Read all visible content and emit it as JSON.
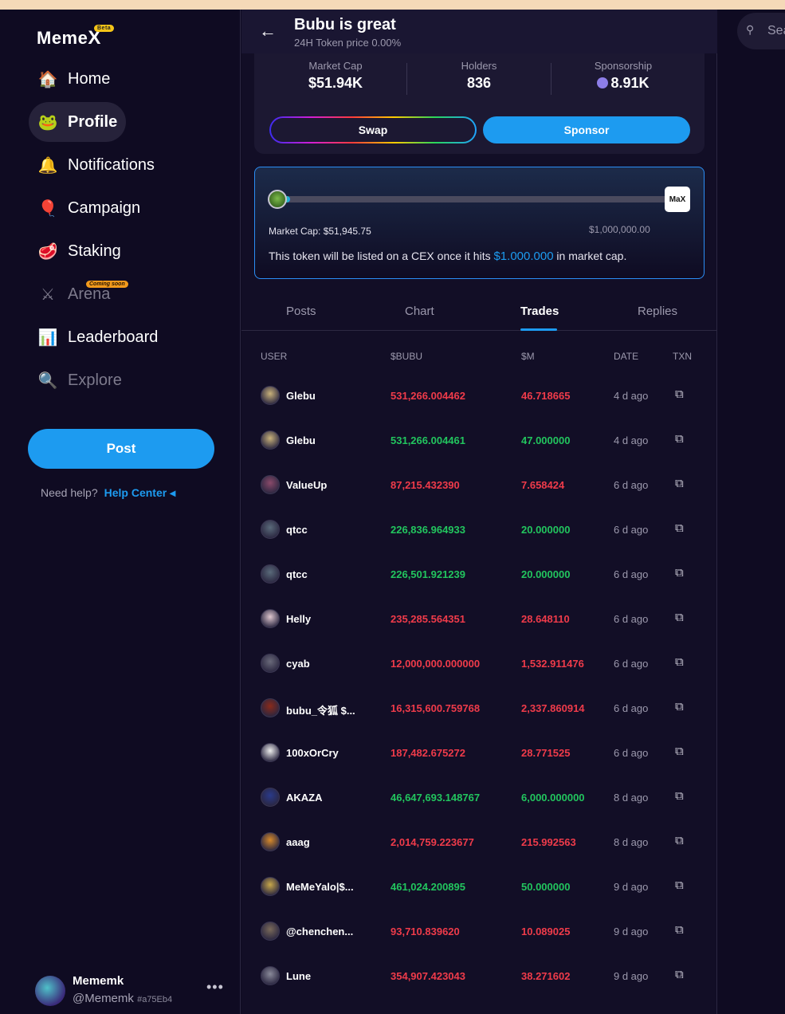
{
  "logo": {
    "text_a": "Meme",
    "text_b": "X",
    "beta": "Beta"
  },
  "nav": [
    {
      "label": "Home",
      "icon": "🏠"
    },
    {
      "label": "Profile",
      "icon": "🐸"
    },
    {
      "label": "Notifications",
      "icon": "🔔"
    },
    {
      "label": "Campaign",
      "icon": "🎈"
    },
    {
      "label": "Staking",
      "icon": "🥩"
    },
    {
      "label": "Arena",
      "icon": "⚔",
      "badge": "Coming soon"
    },
    {
      "label": "Leaderboard",
      "icon": "📊"
    },
    {
      "label": "Explore",
      "icon": "🔍"
    }
  ],
  "post_button": "Post",
  "help": {
    "prefix": "Need help?",
    "link": "Help Center ◂"
  },
  "user": {
    "name": "Mememk",
    "handle": "@Mememk",
    "tag": "#a75Eb4",
    "more": "•••"
  },
  "header": {
    "back": "←",
    "title": "Bubu is great",
    "subtitle": "24H Token price  0.00%"
  },
  "stats": [
    {
      "label": "Market Cap",
      "value": "$51.94K"
    },
    {
      "label": "Holders",
      "value": "836"
    },
    {
      "label": "Sponsorship",
      "value": "8.91K"
    }
  ],
  "buttons": {
    "swap": "Swap",
    "sponsor": "Sponsor"
  },
  "progress": {
    "fraction": 0.0519,
    "market_cap_label": "Market Cap: $51,945.75",
    "target_label": "$1,000,000.00",
    "max_badge": "MaX",
    "cex_prefix": "This token will be listed on a CEX once it hits ",
    "cex_amount": "$1.000.000",
    "cex_suffix": " in market cap."
  },
  "tabs": [
    "Posts",
    "Chart",
    "Trades",
    "Replies"
  ],
  "table": {
    "headers": [
      "USER",
      "$BUBU",
      "$M",
      "DATE",
      "TXN"
    ],
    "rows": [
      {
        "user": "Glebu",
        "token": "531,266.004462",
        "m": "46.718665",
        "date": "4 d ago",
        "side": "red",
        "avatar": "#c9b27a"
      },
      {
        "user": "Glebu",
        "token": "531,266.004461",
        "m": "47.000000",
        "date": "4 d ago",
        "side": "green",
        "avatar": "#c9b27a"
      },
      {
        "user": "ValueUp",
        "token": "87,215.432390",
        "m": "7.658424",
        "date": "6 d ago",
        "side": "red",
        "avatar": "#8a4a6a"
      },
      {
        "user": "qtcc",
        "token": "226,836.964933",
        "m": "20.000000",
        "date": "6 d ago",
        "side": "green",
        "avatar": "#5a6a7a"
      },
      {
        "user": "qtcc",
        "token": "226,501.921239",
        "m": "20.000000",
        "date": "6 d ago",
        "side": "green",
        "avatar": "#5a6a7a"
      },
      {
        "user": "Helly",
        "token": "235,285.564351",
        "m": "28.648110",
        "date": "6 d ago",
        "side": "red",
        "avatar": "#e0c8d0"
      },
      {
        "user": "cyab",
        "token": "12,000,000.000000",
        "m": "1,532.911476",
        "date": "6 d ago",
        "side": "red",
        "avatar": "#6a6a7a"
      },
      {
        "user": "bubu_令狐 $...",
        "token": "16,315,600.759768",
        "m": "2,337.860914",
        "date": "6 d ago",
        "side": "red",
        "avatar": "#8a2a1a"
      },
      {
        "user": "100xOrCry",
        "token": "187,482.675272",
        "m": "28.771525",
        "date": "6 d ago",
        "side": "red",
        "avatar": "#eeeeee"
      },
      {
        "user": "AKAZA",
        "token": "46,647,693.148767",
        "m": "6,000.000000",
        "date": "8 d ago",
        "side": "green",
        "avatar": "#2a3a8a"
      },
      {
        "user": "aaag",
        "token": "2,014,759.223677",
        "m": "215.992563",
        "date": "8 d ago",
        "side": "red",
        "avatar": "#d88a2a"
      },
      {
        "user": "MeMeYalo|$...",
        "token": "461,024.200895",
        "m": "50.000000",
        "date": "9 d ago",
        "side": "green",
        "avatar": "#c8a84a"
      },
      {
        "user": "@chenchen...",
        "token": "93,710.839620",
        "m": "10.089025",
        "date": "9 d ago",
        "side": "red",
        "avatar": "#7a6a5a"
      },
      {
        "user": "Lune",
        "token": "354,907.423043",
        "m": "38.271602",
        "date": "9 d ago",
        "side": "red",
        "avatar": "#8a8a9a"
      }
    ]
  },
  "search": {
    "placeholder": "Sea"
  },
  "colors": {
    "accent": "#1d9bf0",
    "sell": "#ef3b4a",
    "buy": "#22c55e",
    "background": "#0f0b22"
  }
}
